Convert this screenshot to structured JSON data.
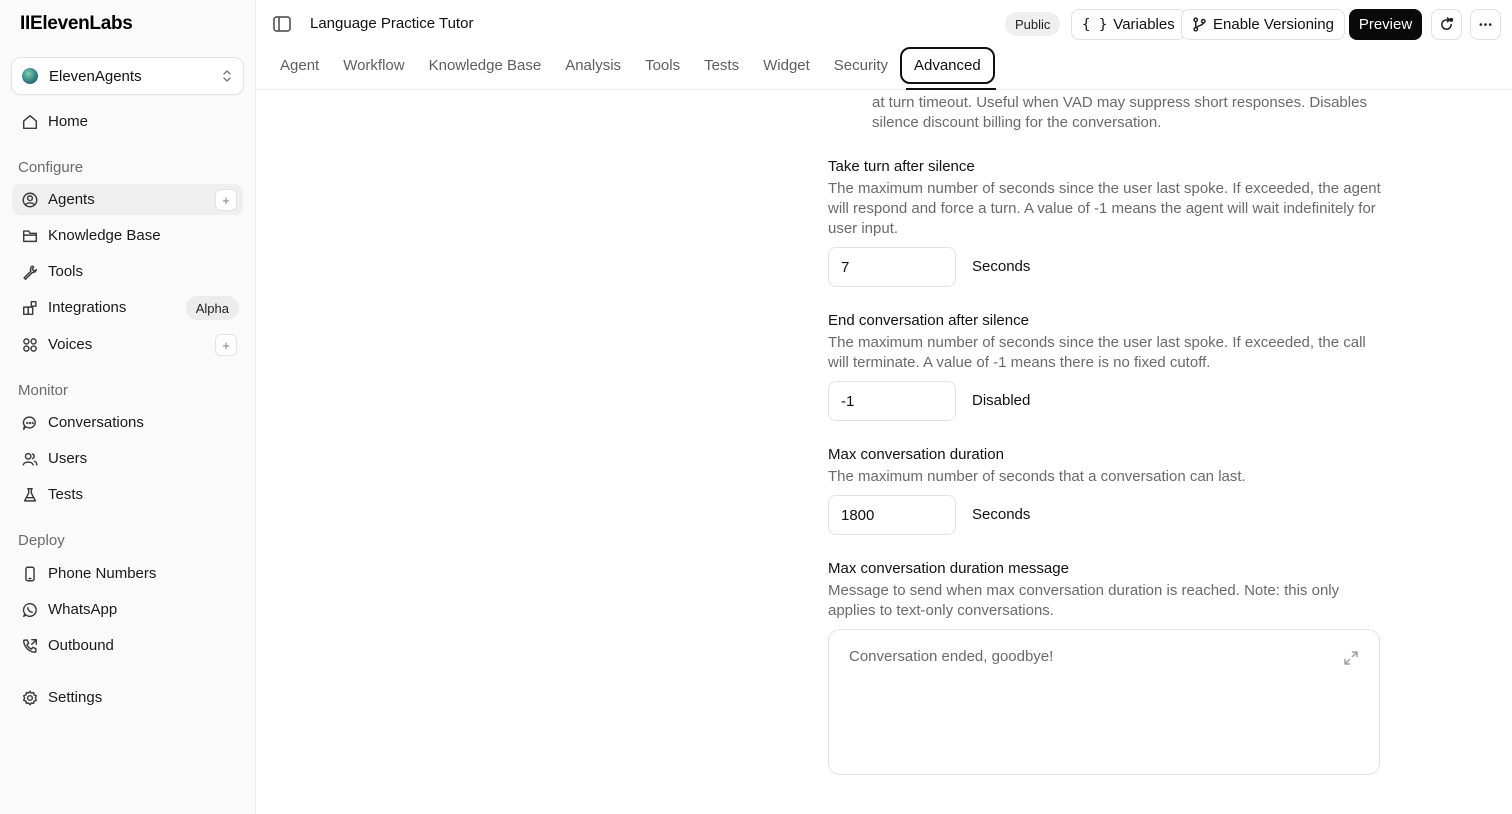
{
  "app": {
    "logo": "IIElevenLabs"
  },
  "workspace": {
    "name": "ElevenAgents"
  },
  "sidebar": {
    "home": "Home",
    "sections": {
      "configure": "Configure",
      "monitor": "Monitor",
      "deploy": "Deploy"
    },
    "configure_items": [
      {
        "label": "Agents"
      },
      {
        "label": "Knowledge Base"
      },
      {
        "label": "Tools"
      },
      {
        "label": "Integrations",
        "badge": "Alpha"
      },
      {
        "label": "Voices"
      }
    ],
    "monitor_items": [
      {
        "label": "Conversations"
      },
      {
        "label": "Users"
      },
      {
        "label": "Tests"
      }
    ],
    "deploy_items": [
      {
        "label": "Phone Numbers"
      },
      {
        "label": "WhatsApp"
      },
      {
        "label": "Outbound"
      }
    ],
    "settings": "Settings",
    "plus": "+"
  },
  "header": {
    "title": "Language Practice Tutor",
    "public_badge": "Public",
    "variables": "Variables",
    "versioning": "Enable Versioning",
    "preview": "Preview",
    "tabs": [
      "Agent",
      "Workflow",
      "Knowledge Base",
      "Analysis",
      "Tools",
      "Tests",
      "Widget",
      "Security",
      "Advanced"
    ]
  },
  "main": {
    "truncated_desc": "at turn timeout. Useful when VAD may suppress short responses. Disables silence discount billing for the conversation.",
    "take_turn": {
      "title": "Take turn after silence",
      "desc": "The maximum number of seconds since the user last spoke. If exceeded, the agent will respond and force a turn. A value of -1 means the agent will wait indefinitely for user input.",
      "value": "7",
      "unit": "Seconds"
    },
    "end_conversation": {
      "title": "End conversation after silence",
      "desc": "The maximum number of seconds since the user last spoke. If exceeded, the call will terminate. A value of -1 means there is no fixed cutoff.",
      "value": "-1",
      "unit": "Disabled"
    },
    "max_duration": {
      "title": "Max conversation duration",
      "desc": "The maximum number of seconds that a conversation can last.",
      "value": "1800",
      "unit": "Seconds"
    },
    "max_duration_message": {
      "title": "Max conversation duration message",
      "desc": "Message to send when max conversation duration is reached. Note: this only applies to text-only conversations.",
      "value": "Conversation ended, goodbye!"
    }
  }
}
